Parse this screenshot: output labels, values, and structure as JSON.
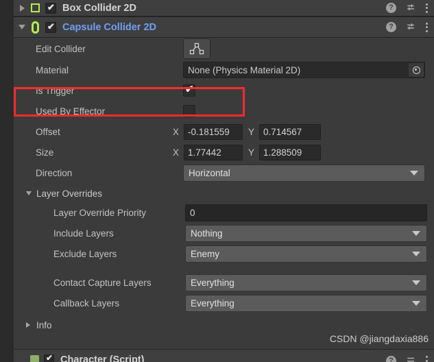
{
  "window": {
    "background": "#3b3b3b",
    "accent_green": "#b4ec51",
    "link_blue": "#6f9ef5",
    "annotation_color": "#ff2b2b"
  },
  "components": [
    {
      "name": "box_collider",
      "title": "Box Collider 2D",
      "icon": "box-collider-2d-icon",
      "expanded": false,
      "enabled": true,
      "foldout_icon": "chevron-right-icon",
      "checkbox_mark": "✔"
    },
    {
      "name": "capsule_collider",
      "title": "Capsule Collider 2D",
      "icon": "capsule-collider-2d-icon",
      "expanded": true,
      "enabled": true,
      "foldout_icon": "chevron-down-icon",
      "checkbox_mark": "✔"
    }
  ],
  "header_icons": {
    "help": "?",
    "help_name": "help-icon",
    "presets_name": "preset-sliders-icon",
    "menu_name": "kebab-menu-icon"
  },
  "properties": {
    "edit_collider": {
      "label": "Edit Collider",
      "button_icon": "polygon-edit-icon"
    },
    "material": {
      "label": "Material",
      "value": "None (Physics Material 2D)",
      "picker_icon": "object-picker-icon"
    },
    "is_trigger": {
      "label": "Is Trigger",
      "checked": true,
      "mark": "✔"
    },
    "used_by_effector": {
      "label": "Used By Effector",
      "checked": false,
      "mark": ""
    },
    "offset": {
      "label": "Offset",
      "x_axis": "X",
      "x_value": "-0.181559",
      "y_axis": "Y",
      "y_value": "0.714567"
    },
    "size": {
      "label": "Size",
      "x_axis": "X",
      "x_value": "1.77442",
      "y_axis": "Y",
      "y_value": "1.288509"
    },
    "direction": {
      "label": "Direction",
      "value": "Horizontal",
      "arrow_icon": "chevron-down-icon"
    }
  },
  "layer_overrides": {
    "section_label": "Layer Overrides",
    "expanded": true,
    "foldout_icon": "chevron-down-icon",
    "priority": {
      "label": "Layer Override Priority",
      "value": "0"
    },
    "include_layers": {
      "label": "Include Layers",
      "value": "Nothing",
      "arrow_icon": "chevron-down-icon"
    },
    "exclude_layers": {
      "label": "Exclude Layers",
      "value": "Enemy",
      "arrow_icon": "chevron-down-icon"
    },
    "contact_capture_layers": {
      "label": "Contact Capture Layers",
      "value": "Everything",
      "arrow_icon": "chevron-down-icon"
    },
    "callback_layers": {
      "label": "Callback Layers",
      "value": "Everything",
      "arrow_icon": "chevron-down-icon"
    }
  },
  "info_section": {
    "label": "Info",
    "expanded": false,
    "foldout_icon": "chevron-right-icon"
  },
  "watermark": {
    "text": "CSDN @jiangdaxia886"
  },
  "bottom_component": {
    "title": "Character (Script)",
    "enabled": true,
    "mark": "✔"
  }
}
